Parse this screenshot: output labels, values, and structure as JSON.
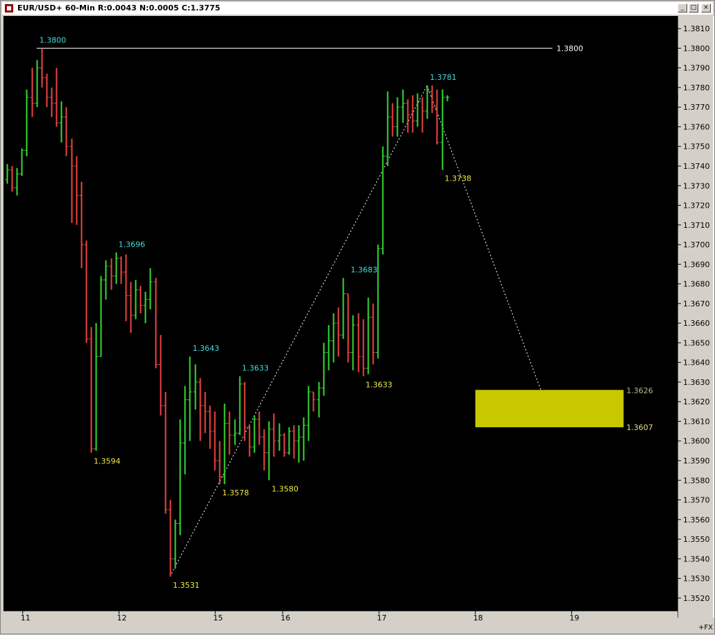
{
  "window": {
    "title": "EUR/USD+ 60-Min R:0.0043 N:0.0005 C:1.3775",
    "minimize_glyph": "_",
    "maximize_glyph": "□",
    "close_glyph": "×"
  },
  "colors": {
    "background": "#000000",
    "bull": "#33dd33",
    "bear": "#ee4444",
    "high_label": "#44dddd",
    "low_label": "#eeee44",
    "zone": "#c8c800",
    "axis_text": "#000000",
    "level_line": "#ffffff"
  },
  "chart_data": {
    "type": "bar",
    "ylim": [
      1.3515,
      1.3815
    ],
    "yticks": [
      "1.3520",
      "1.3530",
      "1.3540",
      "1.3550",
      "1.3560",
      "1.3570",
      "1.3580",
      "1.3590",
      "1.3600",
      "1.3610",
      "1.3620",
      "1.3630",
      "1.3640",
      "1.3650",
      "1.3660",
      "1.3670",
      "1.3680",
      "1.3690",
      "1.3700",
      "1.3710",
      "1.3720",
      "1.3730",
      "1.3740",
      "1.3750",
      "1.3760",
      "1.3770",
      "1.3780",
      "1.3790",
      "1.3800",
      "1.3810"
    ],
    "xlim": [
      0,
      70
    ],
    "xticks": [
      {
        "label": "11",
        "x": 2
      },
      {
        "label": "12",
        "x": 12
      },
      {
        "label": "15",
        "x": 22
      },
      {
        "label": "16",
        "x": 29
      },
      {
        "label": "17",
        "x": 39
      },
      {
        "label": "18",
        "x": 49
      },
      {
        "label": "19",
        "x": 59
      }
    ],
    "right_axis_footer": "+FX",
    "last_price": 1.3775,
    "bars": [
      [
        1.3733,
        1.3741,
        1.3731,
        1.3738
      ],
      [
        1.3738,
        1.374,
        1.3727,
        1.3729
      ],
      [
        1.3729,
        1.3739,
        1.3725,
        1.3736
      ],
      [
        1.3736,
        1.3749,
        1.3735,
        1.3748
      ],
      [
        1.3748,
        1.3779,
        1.3745,
        1.3775
      ],
      [
        1.3775,
        1.379,
        1.3765,
        1.3772
      ],
      [
        1.3772,
        1.3794,
        1.377,
        1.379
      ],
      [
        1.379,
        1.38,
        1.378,
        1.3785
      ],
      [
        1.3785,
        1.3787,
        1.377,
        1.3775
      ],
      [
        1.3775,
        1.378,
        1.3765,
        1.3772
      ],
      [
        1.3772,
        1.379,
        1.376,
        1.3762
      ],
      [
        1.3762,
        1.3773,
        1.3752,
        1.3765
      ],
      [
        1.3765,
        1.377,
        1.3745,
        1.375
      ],
      [
        1.375,
        1.3754,
        1.3711,
        1.374
      ],
      [
        1.374,
        1.3745,
        1.371,
        1.3725
      ],
      [
        1.3725,
        1.3732,
        1.3688,
        1.37
      ],
      [
        1.37,
        1.3702,
        1.365,
        1.3652
      ],
      [
        1.3652,
        1.3658,
        1.3594,
        1.3596
      ],
      [
        1.3596,
        1.366,
        1.3595,
        1.3643
      ],
      [
        1.3643,
        1.3684,
        1.3643,
        1.3682
      ],
      [
        1.3682,
        1.3692,
        1.3672,
        1.3689
      ],
      [
        1.3689,
        1.3693,
        1.3677,
        1.3684
      ],
      [
        1.3684,
        1.3696,
        1.368,
        1.3693
      ],
      [
        1.3693,
        1.3694,
        1.368,
        1.3686
      ],
      [
        1.3686,
        1.3695,
        1.3661,
        1.3674
      ],
      [
        1.3674,
        1.3681,
        1.3655,
        1.3664
      ],
      [
        1.3664,
        1.3682,
        1.3662,
        1.3677
      ],
      [
        1.3677,
        1.3679,
        1.3665,
        1.3669
      ],
      [
        1.3669,
        1.3676,
        1.366,
        1.3672
      ],
      [
        1.3672,
        1.3688,
        1.3667,
        1.3681
      ],
      [
        1.3681,
        1.3683,
        1.3637,
        1.3639
      ],
      [
        1.3639,
        1.3654,
        1.3613,
        1.3618
      ],
      [
        1.3618,
        1.3625,
        1.3563,
        1.3565
      ],
      [
        1.3565,
        1.357,
        1.3531,
        1.354
      ],
      [
        1.354,
        1.356,
        1.3535,
        1.3558
      ],
      [
        1.3558,
        1.3611,
        1.3552,
        1.3599
      ],
      [
        1.3599,
        1.3628,
        1.3583,
        1.3621
      ],
      [
        1.3621,
        1.3643,
        1.36,
        1.3625
      ],
      [
        1.3625,
        1.3639,
        1.3616,
        1.363
      ],
      [
        1.363,
        1.3632,
        1.36,
        1.3618
      ],
      [
        1.3618,
        1.3625,
        1.3604,
        1.3615
      ],
      [
        1.3615,
        1.3618,
        1.3596,
        1.3605
      ],
      [
        1.3605,
        1.3615,
        1.3585,
        1.359
      ],
      [
        1.359,
        1.36,
        1.3578,
        1.3582
      ],
      [
        1.3582,
        1.3619,
        1.3578,
        1.3609
      ],
      [
        1.3609,
        1.3615,
        1.3593,
        1.3603
      ],
      [
        1.3603,
        1.3611,
        1.3598,
        1.3604
      ],
      [
        1.3604,
        1.3633,
        1.3603,
        1.3629
      ],
      [
        1.3629,
        1.363,
        1.36,
        1.3607
      ],
      [
        1.3607,
        1.3608,
        1.3592,
        1.3597
      ],
      [
        1.3597,
        1.3613,
        1.3594,
        1.3611
      ],
      [
        1.3611,
        1.3615,
        1.3598,
        1.3602
      ],
      [
        1.3602,
        1.3606,
        1.3585,
        1.3594
      ],
      [
        1.3594,
        1.361,
        1.358,
        1.3606
      ],
      [
        1.3606,
        1.3614,
        1.3592,
        1.36
      ],
      [
        1.36,
        1.3609,
        1.3595,
        1.3603
      ],
      [
        1.3603,
        1.3604,
        1.3592,
        1.3594
      ],
      [
        1.3594,
        1.3607,
        1.3593,
        1.3605
      ],
      [
        1.3605,
        1.3608,
        1.3591,
        1.36
      ],
      [
        1.36,
        1.3608,
        1.3589,
        1.3602
      ],
      [
        1.3602,
        1.3612,
        1.359,
        1.3608
      ],
      [
        1.3608,
        1.3628,
        1.36,
        1.3625
      ],
      [
        1.3625,
        1.3625,
        1.3615,
        1.3621
      ],
      [
        1.3621,
        1.363,
        1.3612,
        1.3627
      ],
      [
        1.3627,
        1.365,
        1.3623,
        1.3645
      ],
      [
        1.3645,
        1.3659,
        1.3636,
        1.3651
      ],
      [
        1.3651,
        1.3665,
        1.364,
        1.366
      ],
      [
        1.366,
        1.3668,
        1.3643,
        1.3654
      ],
      [
        1.3654,
        1.3683,
        1.3652,
        1.3675
      ],
      [
        1.3675,
        1.3675,
        1.364,
        1.3645
      ],
      [
        1.3645,
        1.3664,
        1.3636,
        1.3659
      ],
      [
        1.3659,
        1.3665,
        1.3635,
        1.3643
      ],
      [
        1.3643,
        1.3662,
        1.3633,
        1.3637
      ],
      [
        1.3637,
        1.3673,
        1.3634,
        1.3663
      ],
      [
        1.3663,
        1.367,
        1.3639,
        1.3645
      ],
      [
        1.3645,
        1.37,
        1.3642,
        1.3698
      ],
      [
        1.3698,
        1.375,
        1.3695,
        1.3745
      ],
      [
        1.3745,
        1.3778,
        1.374,
        1.3765
      ],
      [
        1.3765,
        1.3772,
        1.3755,
        1.376
      ],
      [
        1.376,
        1.3775,
        1.3755,
        1.377
      ],
      [
        1.377,
        1.3779,
        1.3762,
        1.3772
      ],
      [
        1.3772,
        1.3774,
        1.3757,
        1.3766
      ],
      [
        1.3766,
        1.3776,
        1.3757,
        1.3763
      ],
      [
        1.3763,
        1.3777,
        1.376,
        1.3773
      ],
      [
        1.3773,
        1.3775,
        1.3757,
        1.3768
      ],
      [
        1.3768,
        1.3781,
        1.3764,
        1.3778
      ],
      [
        1.3778,
        1.3781,
        1.3767,
        1.377
      ],
      [
        1.377,
        1.3779,
        1.3751,
        1.3752
      ],
      [
        1.3752,
        1.3779,
        1.3738,
        1.3775
      ],
      [
        1.3775,
        1.3776,
        1.3773,
        1.3775
      ]
    ],
    "price_labels": [
      {
        "text": "1.3800",
        "bar": 6,
        "price": 1.38,
        "type": "high"
      },
      {
        "text": "1.3594",
        "bar": 17,
        "price": 1.3594,
        "type": "low"
      },
      {
        "text": "1.3696",
        "bar": 22,
        "price": 1.3696,
        "type": "high"
      },
      {
        "text": "1.3531",
        "bar": 33,
        "price": 1.3531,
        "type": "low"
      },
      {
        "text": "1.3643",
        "bar": 37,
        "price": 1.3643,
        "type": "high"
      },
      {
        "text": "1.3578",
        "bar": 43,
        "price": 1.3578,
        "type": "low"
      },
      {
        "text": "1.3633",
        "bar": 47,
        "price": 1.3633,
        "type": "high"
      },
      {
        "text": "1.3580",
        "bar": 53,
        "price": 1.358,
        "type": "low"
      },
      {
        "text": "1.3683",
        "bar": 69,
        "price": 1.3683,
        "type": "high"
      },
      {
        "text": "1.3633",
        "bar": 72,
        "price": 1.3633,
        "type": "low"
      },
      {
        "text": "1.3781",
        "bar": 85,
        "price": 1.3781,
        "type": "high"
      },
      {
        "text": "1.3738",
        "bar": 88,
        "price": 1.3738,
        "type": "low"
      }
    ],
    "level_line": {
      "label": "1.3800",
      "price": 1.38,
      "from_bar": 6,
      "to_x": 57
    },
    "trend_lines": [
      {
        "from_bar": 33,
        "from_price": 1.3531,
        "to_bar": 85,
        "to_price": 1.3781
      },
      {
        "from_bar": 85,
        "from_price": 1.3781,
        "to_x": 55.8,
        "to_price": 1.3626
      }
    ],
    "zone": {
      "top": 1.3626,
      "bottom": 1.3607,
      "x_start": 49,
      "x_end": 64.4,
      "top_label": "1.3626",
      "bottom_label": "1.3607"
    }
  }
}
